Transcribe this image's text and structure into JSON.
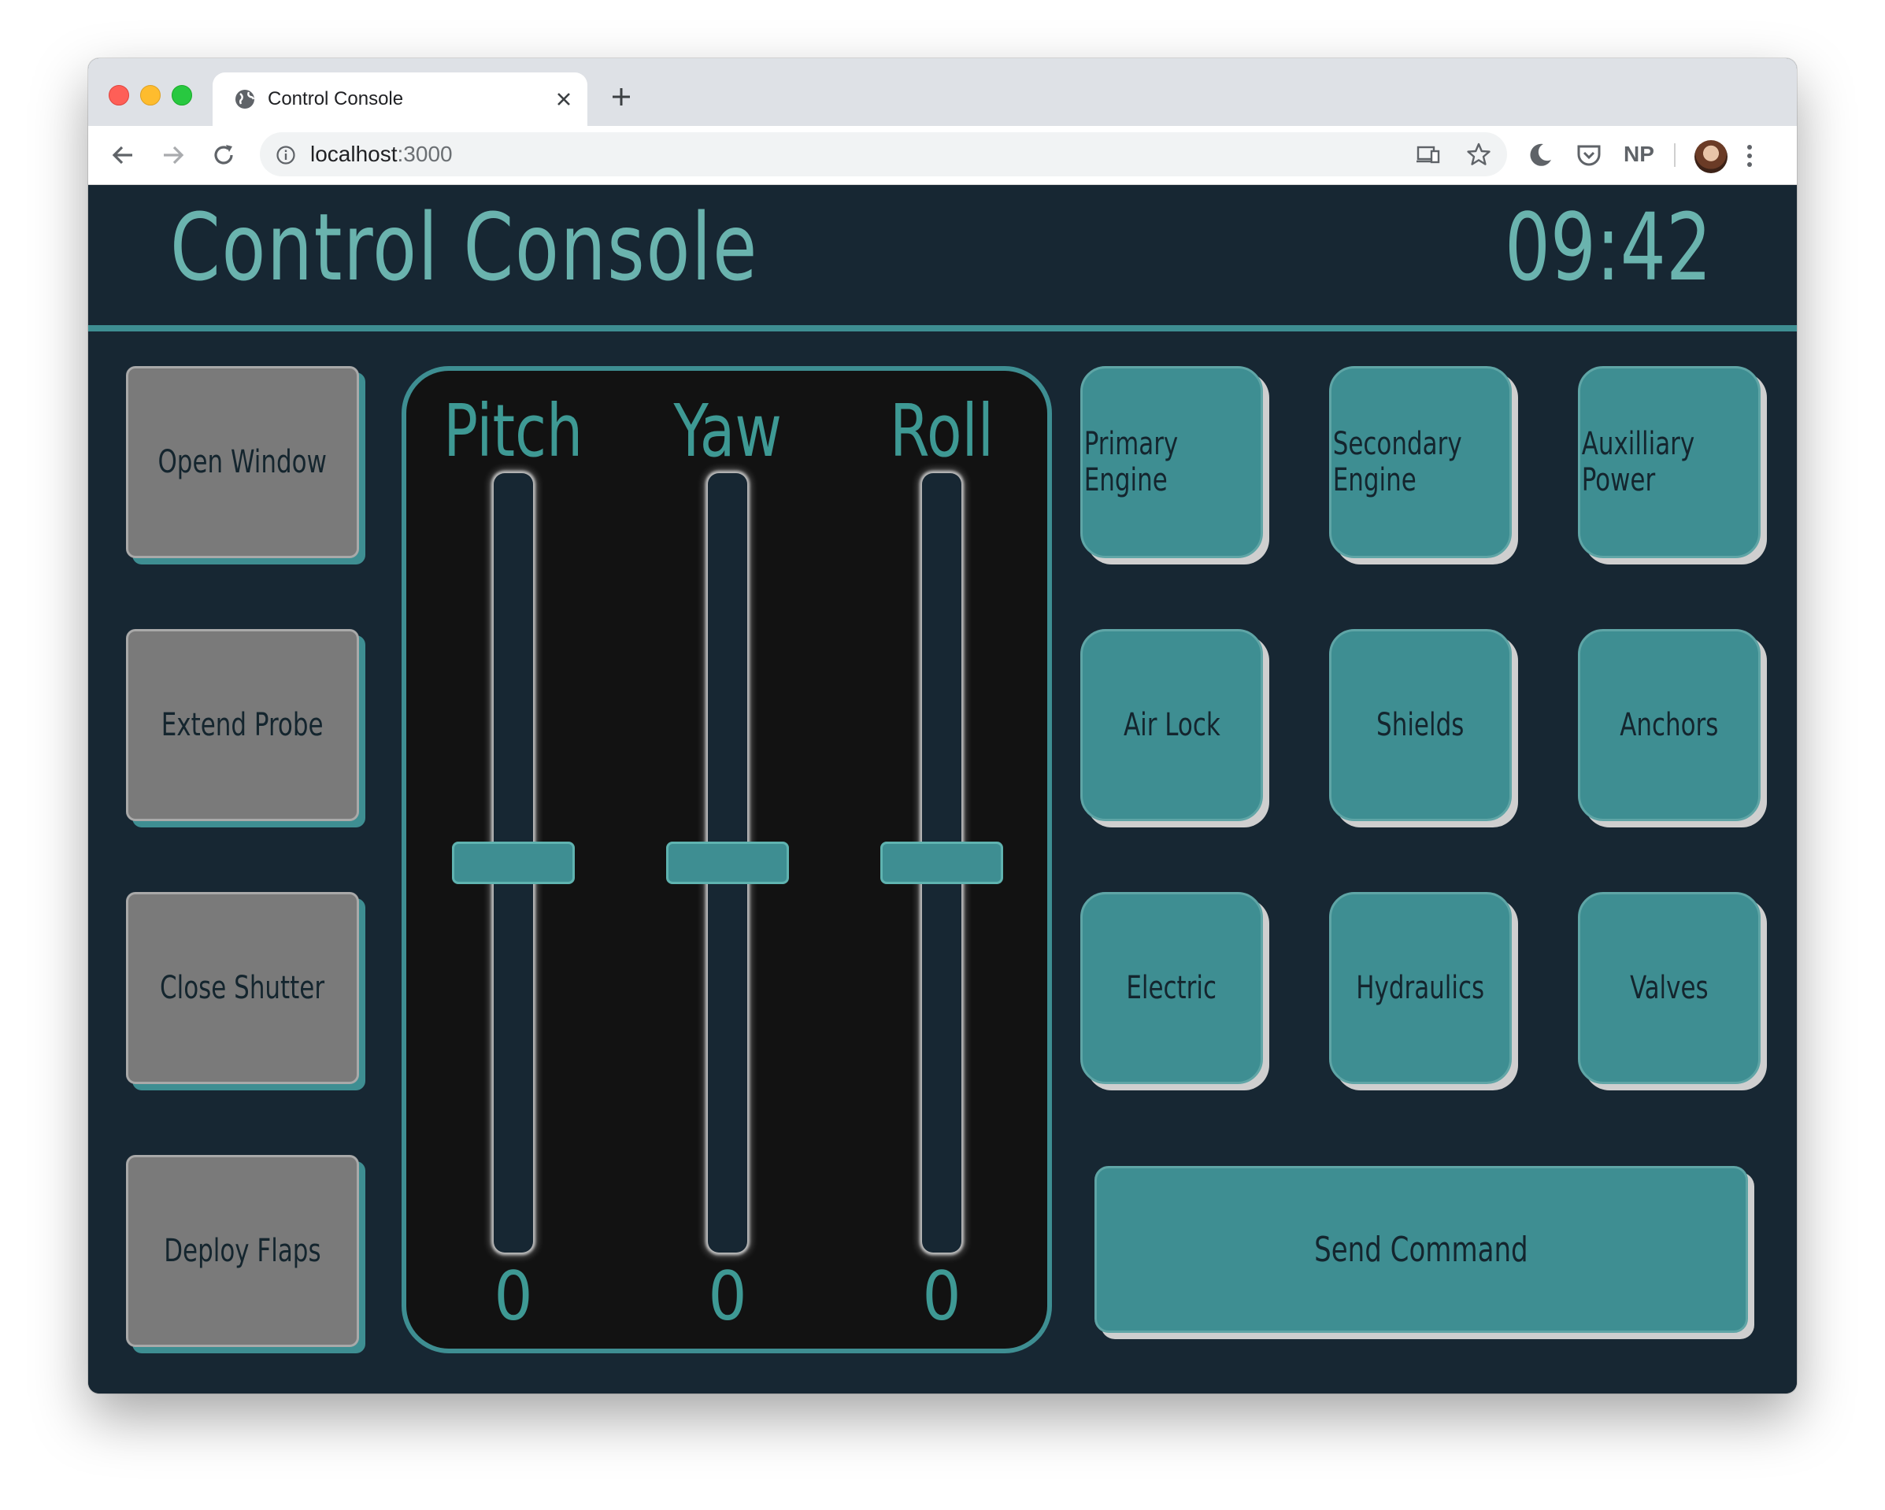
{
  "browser": {
    "tab_title": "Control Console",
    "url_host": "localhost",
    "url_port": ":3000",
    "extension_np": "NP"
  },
  "app": {
    "title": "Control Console",
    "clock": "09:42",
    "colors": {
      "background": "#172733",
      "accent": "#3e8e92",
      "text_accent": "#6ab3ae",
      "gray_button": "#7a7a7a"
    },
    "gray_buttons": [
      {
        "label": "Open Window"
      },
      {
        "label": "Extend Probe"
      },
      {
        "label": "Close Shutter"
      },
      {
        "label": "Deploy Flaps"
      }
    ],
    "sliders": [
      {
        "label": "Pitch",
        "value": "0",
        "level": 0.5
      },
      {
        "label": "Yaw",
        "value": "0",
        "level": 0.5
      },
      {
        "label": "Roll",
        "value": "0",
        "level": 0.5
      }
    ],
    "system_buttons": [
      {
        "line1": "Primary",
        "line2": "Engine"
      },
      {
        "line1": "Secondary",
        "line2": "Engine"
      },
      {
        "line1": "Auxilliary",
        "line2": "Power"
      },
      {
        "label": "Air Lock"
      },
      {
        "label": "Shields"
      },
      {
        "label": "Anchors"
      },
      {
        "label": "Electric"
      },
      {
        "label": "Hydraulics"
      },
      {
        "label": "Valves"
      }
    ],
    "send_label": "Send Command"
  }
}
